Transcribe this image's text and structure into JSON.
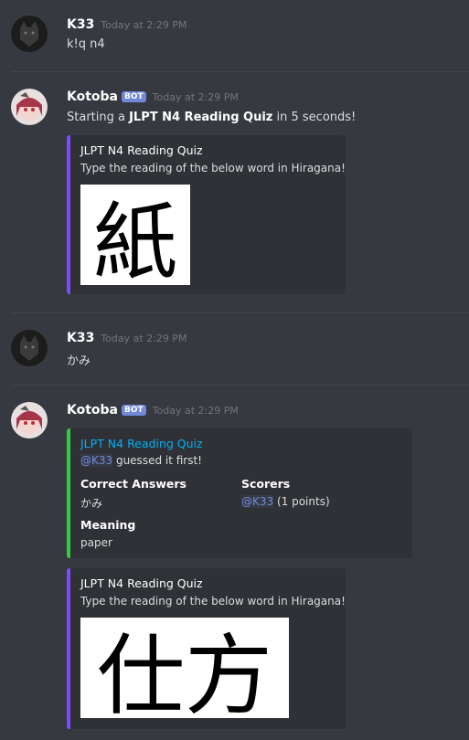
{
  "messages": [
    {
      "author": "K33",
      "timestamp": "Today at 2:29 PM",
      "text": "k!q n4"
    },
    {
      "author": "Kotoba",
      "bot_tag": "BOT",
      "timestamp": "Today at 2:29 PM",
      "text_prefix": "Starting a ",
      "text_bold": "JLPT N4 Reading Quiz",
      "text_suffix": " in 5 seconds!",
      "embed": {
        "title": "JLPT N4 Reading Quiz",
        "description": "Type the reading of the below word in Hiragana!",
        "kanji": "紙",
        "accent": "#7c4dff"
      }
    },
    {
      "author": "K33",
      "timestamp": "Today at 2:29 PM",
      "text": "かみ"
    },
    {
      "author": "Kotoba",
      "bot_tag": "BOT",
      "timestamp": "Today at 2:29 PM",
      "result_embed": {
        "title": "JLPT N4 Reading Quiz",
        "mention": "@K33",
        "description_suffix": " guessed it first!",
        "correct_answers_label": "Correct Answers",
        "correct_answers_value": "かみ",
        "scorers_label": "Scorers",
        "scorers_mention": "@K33",
        "scorers_suffix": " (1 points)",
        "meaning_label": "Meaning",
        "meaning_value": "paper",
        "accent": "#2ecc40"
      },
      "embed": {
        "title": "JLPT N4 Reading Quiz",
        "description": "Type the reading of the below word in Hiragana!",
        "kanji": "仕方",
        "accent": "#7c4dff"
      }
    }
  ]
}
